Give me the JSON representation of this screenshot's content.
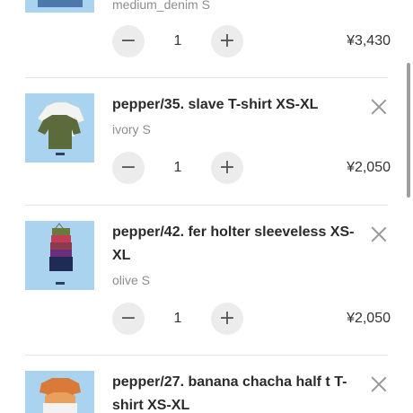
{
  "colors": {
    "accent": "#a9d3ef",
    "button_bg": "#ececec",
    "text": "#333333",
    "muted": "#8d8d8d"
  },
  "items": [
    {
      "title": "",
      "variant": "medium_denim S",
      "quantity": "1",
      "price": "¥3,430",
      "minus": "−",
      "plus": "+"
    },
    {
      "title": "pepper/35. slave T-shirt XS-XL",
      "variant": "ivory S",
      "quantity": "1",
      "price": "¥2,050",
      "minus": "−",
      "plus": "+"
    },
    {
      "title": "pepper/42. fer holter sleeveless XS-XL",
      "variant": "olive S",
      "quantity": "1",
      "price": "¥2,050",
      "minus": "−",
      "plus": "+"
    },
    {
      "title": "pepper/27. banana chacha half t T-shirt XS-XL",
      "variant": "",
      "quantity": "",
      "price": "",
      "minus": "",
      "plus": ""
    }
  ],
  "icons": {
    "remove": "close-icon",
    "minus": "minus-icon",
    "plus": "plus-icon"
  }
}
